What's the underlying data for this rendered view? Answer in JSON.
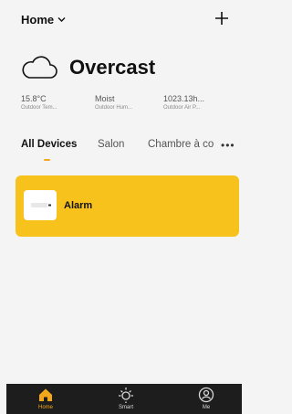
{
  "header": {
    "home_label": "Home"
  },
  "weather": {
    "condition": "Overcast"
  },
  "stats": [
    {
      "value": "15.8°C",
      "label": "Outdoor Tem..."
    },
    {
      "value": "Moist",
      "label": "Outdoor Hum..."
    },
    {
      "value": "1023.13h...",
      "label": "Outdoor Air P..."
    }
  ],
  "tabs": [
    {
      "label": "All Devices"
    },
    {
      "label": "Salon"
    },
    {
      "label": "Chambre à co"
    }
  ],
  "device": {
    "label": "Alarm"
  },
  "bottom_nav": [
    {
      "label": "Home"
    },
    {
      "label": "Smart"
    },
    {
      "label": "Me"
    }
  ],
  "colors": {
    "accent": "#f3a81b",
    "card": "#f8c21c",
    "tabbar": "#1d1d1d"
  }
}
